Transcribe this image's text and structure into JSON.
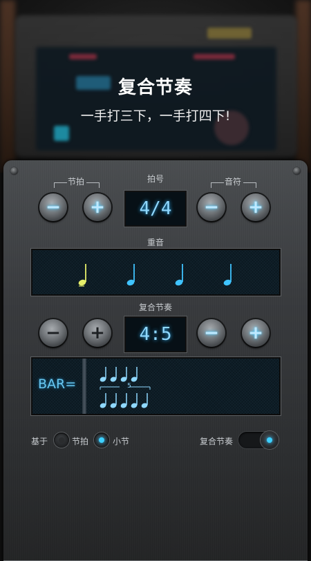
{
  "promo": {
    "title": "复合节奏",
    "subtitle": "一手打三下，一手打四下!"
  },
  "time_signature": {
    "beat_label": "节拍",
    "label": "拍号",
    "note_label": "音符",
    "value": "4/4",
    "beat_minus_icon": "minus-icon",
    "beat_plus_icon": "plus-icon",
    "note_minus_icon": "minus-icon",
    "note_plus_icon": "plus-icon"
  },
  "accent": {
    "label": "重音",
    "beats": 4,
    "accented_beat": 1,
    "accent_color": "#e6ef6a",
    "note_color": "#3fc3ff"
  },
  "polyrhythm": {
    "label": "复合节奏",
    "value": "4:5",
    "bar_label": "BAR=",
    "top_notes": 4,
    "bottom_notes": 5,
    "tuplet_number": "5"
  },
  "options": {
    "based_on_label": "基于",
    "beat_label": "节拍",
    "bar_label": "小节",
    "selected": "小节",
    "polyrhythm_label": "复合节奏",
    "polyrhythm_enabled": true
  }
}
